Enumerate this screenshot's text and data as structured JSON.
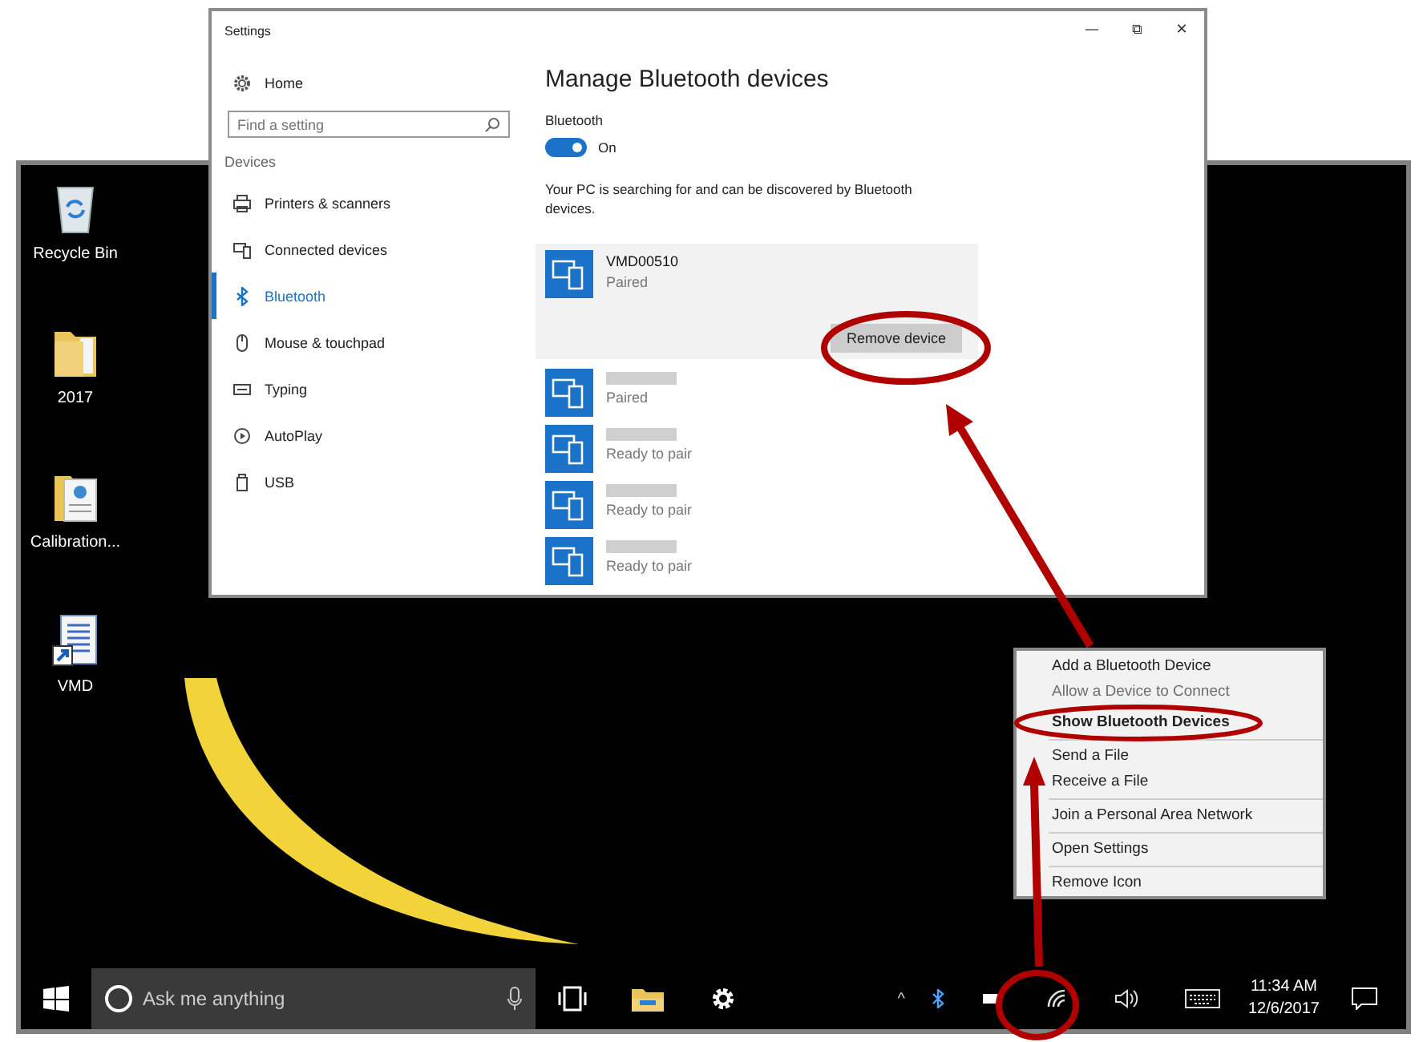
{
  "desktop": {
    "icons": [
      {
        "label": "Recycle Bin",
        "kind": "recycle-bin"
      },
      {
        "label": "2017",
        "kind": "folder"
      },
      {
        "label": "Calibration...",
        "kind": "folder-document"
      },
      {
        "label": "VMD",
        "kind": "shortcut-document"
      }
    ]
  },
  "settings_window": {
    "title": "Settings",
    "window_controls": [
      "—",
      "⧉",
      "✕"
    ],
    "nav": {
      "home": "Home",
      "search": {
        "placeholder": "Find a setting"
      },
      "section": "Devices",
      "items": [
        {
          "label": "Printers & scanners",
          "kind": "printer",
          "selected": false
        },
        {
          "label": "Connected devices",
          "kind": "devices",
          "selected": false
        },
        {
          "label": "Bluetooth",
          "kind": "bluetooth",
          "selected": true
        },
        {
          "label": "Mouse & touchpad",
          "kind": "mouse",
          "selected": false
        },
        {
          "label": "Typing",
          "kind": "keyboard",
          "selected": false
        },
        {
          "label": "AutoPlay",
          "kind": "autoplay",
          "selected": false
        },
        {
          "label": "USB",
          "kind": "usb",
          "selected": false
        }
      ]
    },
    "page": {
      "heading": "Manage Bluetooth devices",
      "toggle": {
        "label": "Bluetooth",
        "on": true,
        "state_text": "On"
      },
      "description": "Your PC is searching for and can be discovered by Bluetooth devices.",
      "devices": [
        {
          "name": "VMD00510",
          "status": "Paired",
          "selected": true,
          "button": "Remove device"
        },
        {
          "redacted": true,
          "status": "Paired",
          "selected": false
        },
        {
          "redacted": true,
          "status": "Ready to pair",
          "selected": false
        },
        {
          "redacted": true,
          "status": "Ready to pair",
          "selected": false
        },
        {
          "redacted": true,
          "status": "Ready to pair",
          "selected": false
        }
      ]
    }
  },
  "context_menu": {
    "groups": [
      [
        {
          "label": "Add a Bluetooth Device",
          "kind": "normal"
        },
        {
          "label": "Allow a Device to Connect",
          "kind": "disabled"
        },
        {
          "label": "Show Bluetooth Devices",
          "kind": "default"
        }
      ],
      [
        {
          "label": "Send a File",
          "kind": "normal"
        },
        {
          "label": "Receive a File",
          "kind": "normal"
        }
      ],
      [
        {
          "label": "Join a Personal Area Network",
          "kind": "normal"
        }
      ],
      [
        {
          "label": "Open Settings",
          "kind": "normal"
        }
      ],
      [
        {
          "label": "Remove Icon",
          "kind": "normal"
        }
      ]
    ]
  },
  "taskbar": {
    "search": {
      "placeholder": "Ask me anything"
    },
    "tray_overflow": "^",
    "clock": {
      "time": "11:34 AM",
      "date": "12/6/2017"
    }
  }
}
